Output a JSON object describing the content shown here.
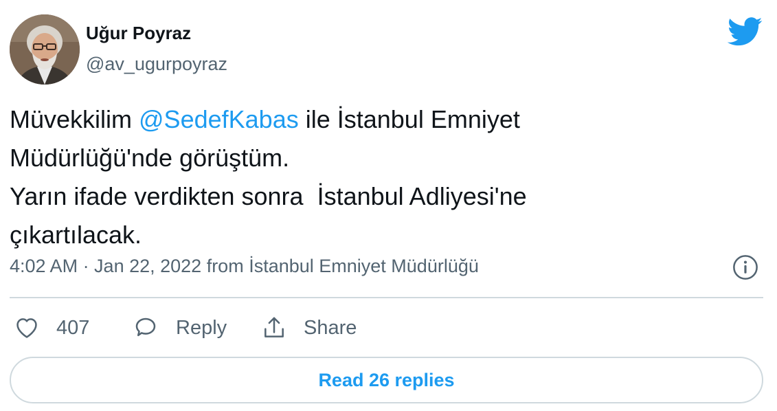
{
  "author": {
    "name": "Uğur Poyraz",
    "handle": "@av_ugurpoyraz",
    "avatar_icon": "profile-photo"
  },
  "tweet": {
    "lines": [
      {
        "before": "Müvekkilim ",
        "mention": "@SedefKabas",
        "after": " ile İstanbul Emniyet"
      },
      {
        "text": "Müdürlüğü'nde görüştüm."
      },
      {
        "text": "Yarın ifade verdikten sonra  İstanbul Adliyesi'ne"
      },
      {
        "text": "çıkartılacak."
      }
    ],
    "meta": "4:02 AM · Jan 22, 2022 from İstanbul Emniyet Müdürlüğü"
  },
  "actions": {
    "likes": "407",
    "reply_label": "Reply",
    "share_label": "Share"
  },
  "read_replies_label": "Read 26 replies",
  "colors": {
    "accent": "#1d9bf0",
    "text": "#0f1419",
    "muted": "#536471",
    "border": "#cfd9de"
  },
  "icons": [
    "twitter-bird-icon",
    "info-icon",
    "heart-icon",
    "reply-bubble-icon",
    "share-icon"
  ]
}
